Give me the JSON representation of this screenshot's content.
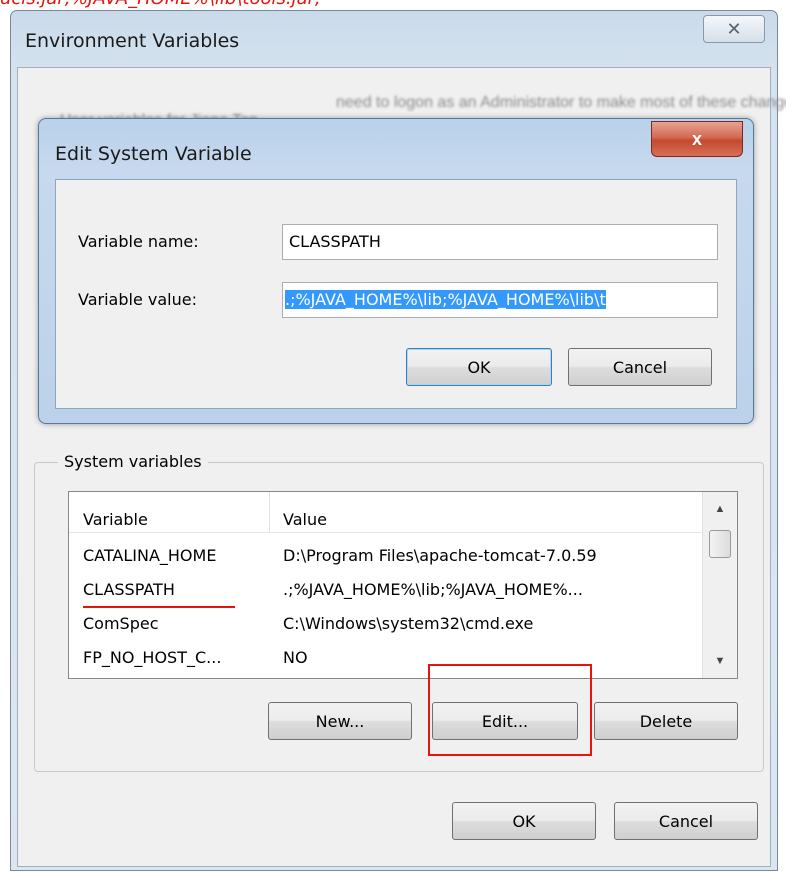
{
  "annotation": {
    "top_fragment": "ucls.jar;%JAVA_HOME%\\lib\\tools.jar;"
  },
  "env_window": {
    "title": "Environment Variables",
    "close_glyph": "✕",
    "blurred_text": [
      "User variables for Jiana Tan",
      "need to logon as an Administrator to make most of these changes"
    ],
    "system_group": {
      "legend": "System variables",
      "columns": [
        "Variable",
        "Value"
      ],
      "rows": [
        {
          "variable": "CATALINA_HOME",
          "value": "D:\\Program Files\\apache-tomcat-7.0.59"
        },
        {
          "variable": "CLASSPATH",
          "value": ".;%JAVA_HOME%\\lib;%JAVA_HOME%..."
        },
        {
          "variable": "ComSpec",
          "value": "C:\\Windows\\system32\\cmd.exe"
        },
        {
          "variable": "FP_NO_HOST_C...",
          "value": "NO"
        }
      ],
      "buttons": {
        "new": "New...",
        "edit": "Edit...",
        "delete": "Delete"
      }
    },
    "footer_buttons": {
      "ok": "OK",
      "cancel": "Cancel"
    }
  },
  "edit_dialog": {
    "title": "Edit System Variable",
    "close_glyph": "x",
    "name_label": "Variable name:",
    "name_value": "CLASSPATH",
    "value_label": "Variable value:",
    "value_value": ".;%JAVA_HOME%\\lib;%JAVA_HOME%\\lib\\t",
    "ok": "OK",
    "cancel": "Cancel"
  },
  "colors": {
    "annotation_red": "#e8140c",
    "selection_blue": "#3399ff"
  }
}
